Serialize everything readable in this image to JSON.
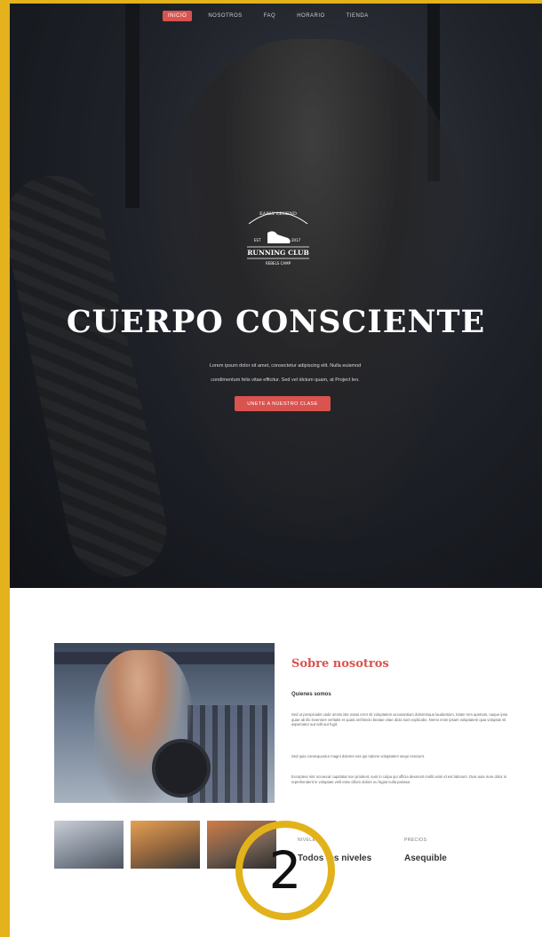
{
  "nav": {
    "items": [
      {
        "label": "INICIO",
        "active": true
      },
      {
        "label": "NOSOTROS",
        "active": false
      },
      {
        "label": "FAQ",
        "active": false
      },
      {
        "label": "HORARIO",
        "active": false
      },
      {
        "label": "TIENDA",
        "active": false
      }
    ]
  },
  "hero": {
    "logo": {
      "top_text": "EARLY LEGEND",
      "left_year": "EST",
      "right_year": "2017",
      "main_text": "RUNNING CLUB",
      "bottom_text": "REBELS CAMP"
    },
    "title": "CUERPO CONSCIENTE",
    "desc_line1": "Lorem ipsum dolor sit amet, consectetur adipiscing elit. Nulla euismod",
    "desc_line2": "condimentum felis vitae efficitur. Sed vel dictum quam, at Project leo.",
    "cta_label": "UNETE A NUESTRO CLASE"
  },
  "about": {
    "title": "Sobre nosotros",
    "subtitle": "Quienes somos",
    "paragraphs": [
      "Sed ut perspiciatis unde omnis iste natus error sit voluptatem accusantium doloremque laudantium, totam rem aperiam, eaque ipsa quae ab illo inventore veritatis et quasi architecto beatae vitae dicta sunt explicabo. Nemo enim ipsam voluptatem quia voluptas sit aspernatur aut odit aut fugit.",
      "Sed quia consequuntur magni dolores eos qui ratione voluptatem sequi nesciunt.",
      "Excepteur sint occaecat cupidatat non proident, sunt in culpa qui officia deserunt mollit anim id est laborum. Duis aute irure dolor in reprehenderit in voluptate velit esse cillum dolore eu fugiat nulla pariatur."
    ],
    "stats": [
      {
        "label": "NIVELES",
        "value": "Todos los niveles"
      },
      {
        "label": "PRECIOS",
        "value": "Asequible"
      }
    ]
  },
  "badge": {
    "number": "2"
  },
  "colors": {
    "accent": "#d9534f",
    "frame": "#e3b21c"
  }
}
